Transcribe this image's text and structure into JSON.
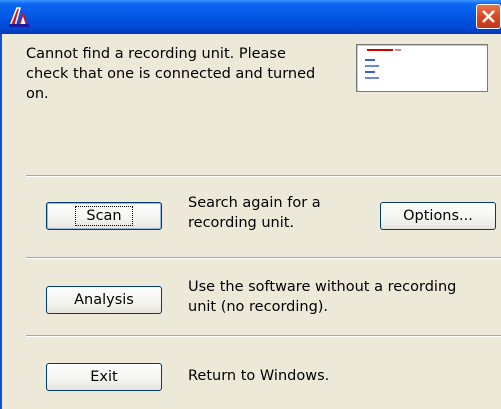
{
  "window": {
    "icon": "app-logo-icon",
    "close_icon": "close-icon"
  },
  "message": {
    "text": "Cannot find a recording unit. Please check that one is connected and turned on."
  },
  "thumbnail": {
    "icon": "powerchrom-screen-thumbnail"
  },
  "actions": [
    {
      "button_label": "Scan",
      "description": "Search again for a recording unit."
    },
    {
      "button_label": "Analysis",
      "description": "Use the software without a recording unit (no recording)."
    },
    {
      "button_label": "Exit",
      "description": "Return to Windows."
    }
  ],
  "options_button": {
    "label": "Options..."
  },
  "colors": {
    "titlebar": "#0458e6",
    "dialog_bg": "#ece9d8",
    "close_button": "#d54424",
    "button_border": "#003c74"
  }
}
